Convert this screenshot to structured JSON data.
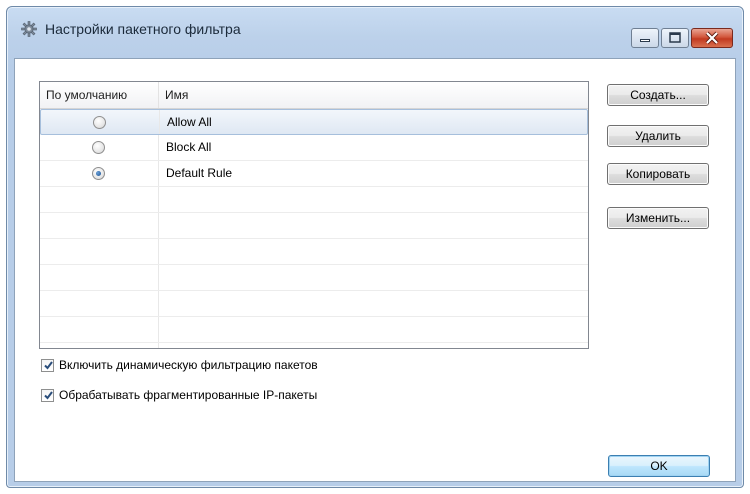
{
  "window": {
    "title": "Настройки пакетного фильтра"
  },
  "list": {
    "columns": [
      "По умолчанию",
      "Имя"
    ],
    "rows": [
      {
        "name": "Allow All",
        "default": false,
        "selected": true
      },
      {
        "name": "Block All",
        "default": false,
        "selected": false
      },
      {
        "name": "Default Rule",
        "default": true,
        "selected": false
      }
    ]
  },
  "buttons": {
    "create": "Создать...",
    "delete": "Удалить",
    "copy": "Копировать",
    "edit": "Изменить...",
    "ok": "OK"
  },
  "options": {
    "dynamic_filtering": {
      "label": "Включить динамическую фильтрацию пакетов",
      "checked": true
    },
    "fragmented_ip": {
      "label": "Обрабатывать фрагментированные IP-пакеты",
      "checked": true
    }
  },
  "icons": {
    "title": "gear-icon",
    "minimize": "minimize-icon",
    "maximize": "maximize-icon",
    "close": "close-icon"
  }
}
